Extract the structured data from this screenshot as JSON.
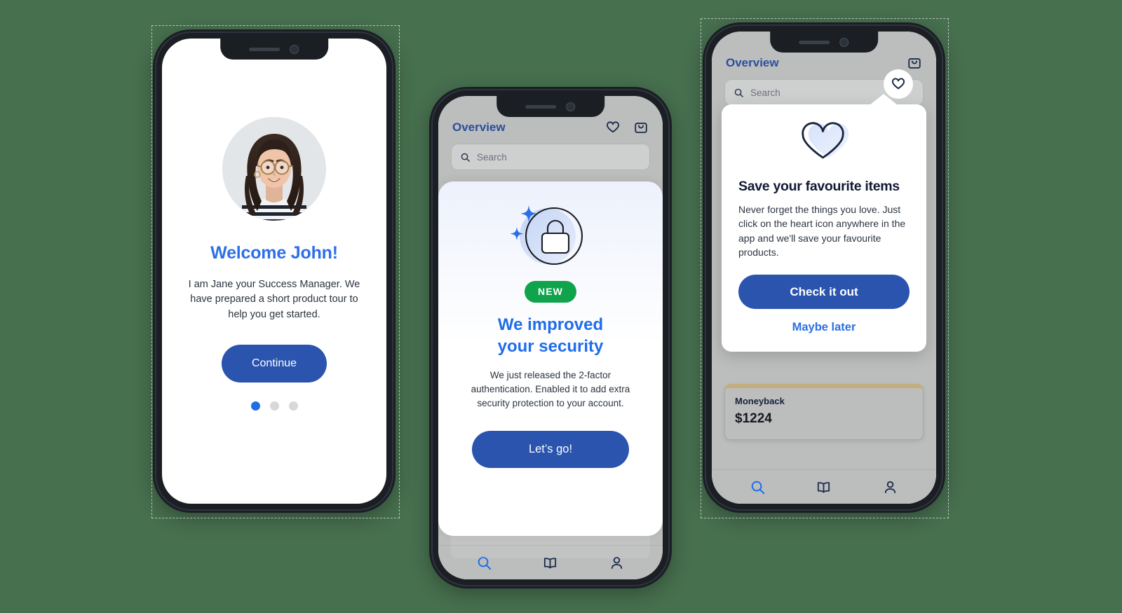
{
  "background_color": "#47704f",
  "accent_blue": "#1f6dea",
  "button_blue": "#2a54ae",
  "badge_green": "#0fa34c",
  "navy": "#1d2b4a",
  "phone1": {
    "name": "onboarding-welcome-screen",
    "avatar_alt": "Photo of Jane, smiling woman with glasses and striped shirt",
    "title": "Welcome John!",
    "body": "I am Jane your Success Manager. We have prepared a short product tour to help you get started.",
    "cta_label": "Continue",
    "pagination": {
      "total": 3,
      "active_index": 0
    }
  },
  "phone2": {
    "name": "security-announcement-screen",
    "header": {
      "title": "Overview",
      "icons": [
        "heart-icon",
        "shopping-bag-icon"
      ]
    },
    "search": {
      "placeholder": "Search",
      "value": "",
      "icon": "search-icon"
    },
    "card": {
      "illustration": "padlock-with-sparkles-icon",
      "badge": "NEW",
      "title_line1": "We improved",
      "title_line2": "your security",
      "body": "We just released the 2-factor authentication. Enabled it to add extra security protection to your account.",
      "cta_label": "Let’s go!"
    },
    "bottom_nav": [
      {
        "icon": "search-icon",
        "active": true
      },
      {
        "icon": "book-icon",
        "active": false
      },
      {
        "icon": "person-icon",
        "active": false
      }
    ]
  },
  "phone3": {
    "name": "favourites-tooltip-screen",
    "header": {
      "title": "Overview",
      "icons": [
        "heart-icon",
        "shopping-bag-icon"
      ],
      "highlighted_icon": "heart-icon"
    },
    "search": {
      "placeholder": "Search",
      "value": "",
      "icon": "search-icon"
    },
    "tooltip": {
      "illustration": "heart-icon",
      "title": "Save your favourite items",
      "body": "Never forget the things you love. Just click on the heart icon anywhere in the app and we'll save your favourite products.",
      "primary_label": "Check it out",
      "secondary_label": "Maybe later"
    },
    "money_card": {
      "label": "Moneyback",
      "value": "$1224",
      "accent_color": "#c4ad7e"
    },
    "bottom_nav": [
      {
        "icon": "search-icon",
        "active": true
      },
      {
        "icon": "book-icon",
        "active": false
      },
      {
        "icon": "person-icon",
        "active": false
      }
    ]
  }
}
